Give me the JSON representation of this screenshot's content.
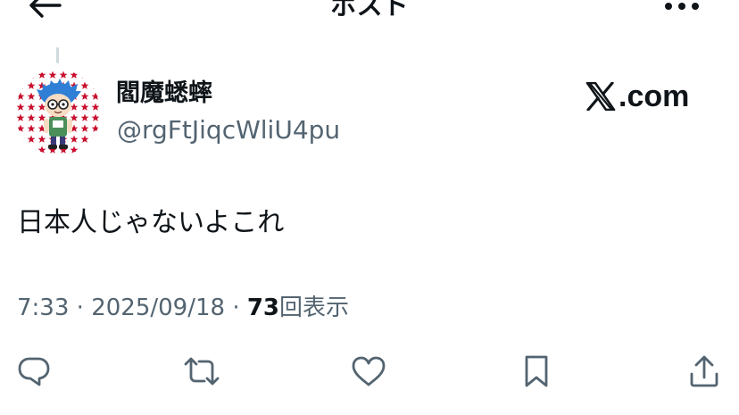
{
  "header": {
    "title": "ポスト",
    "back_icon": "arrow-left-icon",
    "more_icon": "more-horizontal-icon"
  },
  "author": {
    "display_name": "閻魔蟋蟀",
    "handle": "@rgFtJiqcWliU4pu"
  },
  "brand": {
    "label": ".com",
    "icon": "x-logo-icon"
  },
  "post": {
    "text": "日本人じゃないよこれ"
  },
  "meta": {
    "time": "7:33",
    "separator": "·",
    "date": "2025/09/18",
    "views_count": "73",
    "views_label": "回表示"
  },
  "actions": [
    {
      "name": "reply",
      "icon": "reply-icon"
    },
    {
      "name": "repost",
      "icon": "repost-icon"
    },
    {
      "name": "like",
      "icon": "heart-icon"
    },
    {
      "name": "bookmark",
      "icon": "bookmark-icon"
    },
    {
      "name": "share",
      "icon": "share-icon"
    }
  ],
  "colors": {
    "text_primary": "#0f1419",
    "text_secondary": "#536471",
    "thread_line": "#cfd9de",
    "avatar_red": "#c8102e",
    "avatar_blue": "#2f7fd6"
  }
}
